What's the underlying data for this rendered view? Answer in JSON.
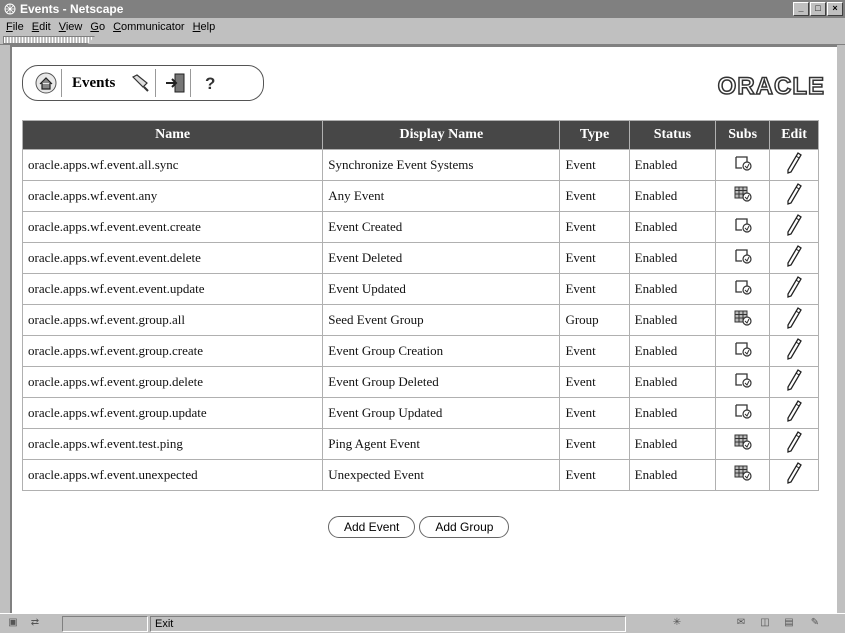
{
  "window": {
    "title": "Events - Netscape"
  },
  "menu": [
    "File",
    "Edit",
    "View",
    "Go",
    "Communicator",
    "Help"
  ],
  "nav": {
    "label": "Events",
    "brand": "ORACLE"
  },
  "table": {
    "columns": [
      "Name",
      "Display Name",
      "Type",
      "Status",
      "Subs",
      "Edit"
    ],
    "rows": [
      {
        "name": "oracle.apps.wf.event.all.sync",
        "display": "Synchronize Event Systems",
        "type": "Event",
        "status": "Enabled",
        "subs": "single"
      },
      {
        "name": "oracle.apps.wf.event.any",
        "display": "Any Event",
        "type": "Event",
        "status": "Enabled",
        "subs": "grid"
      },
      {
        "name": "oracle.apps.wf.event.event.create",
        "display": "Event Created",
        "type": "Event",
        "status": "Enabled",
        "subs": "single"
      },
      {
        "name": "oracle.apps.wf.event.event.delete",
        "display": "Event Deleted",
        "type": "Event",
        "status": "Enabled",
        "subs": "single"
      },
      {
        "name": "oracle.apps.wf.event.event.update",
        "display": "Event Updated",
        "type": "Event",
        "status": "Enabled",
        "subs": "single"
      },
      {
        "name": "oracle.apps.wf.event.group.all",
        "display": "Seed Event Group",
        "type": "Group",
        "status": "Enabled",
        "subs": "grid"
      },
      {
        "name": "oracle.apps.wf.event.group.create",
        "display": "Event Group Creation",
        "type": "Event",
        "status": "Enabled",
        "subs": "single"
      },
      {
        "name": "oracle.apps.wf.event.group.delete",
        "display": "Event Group Deleted",
        "type": "Event",
        "status": "Enabled",
        "subs": "single"
      },
      {
        "name": "oracle.apps.wf.event.group.update",
        "display": "Event Group Updated",
        "type": "Event",
        "status": "Enabled",
        "subs": "single"
      },
      {
        "name": "oracle.apps.wf.event.test.ping",
        "display": "Ping Agent Event",
        "type": "Event",
        "status": "Enabled",
        "subs": "grid"
      },
      {
        "name": "oracle.apps.wf.event.unexpected",
        "display": "Unexpected Event",
        "type": "Event",
        "status": "Enabled",
        "subs": "grid"
      }
    ]
  },
  "buttons": {
    "add_event": "Add Event",
    "add_group": "Add Group"
  },
  "statusbar": {
    "message": "Exit"
  }
}
